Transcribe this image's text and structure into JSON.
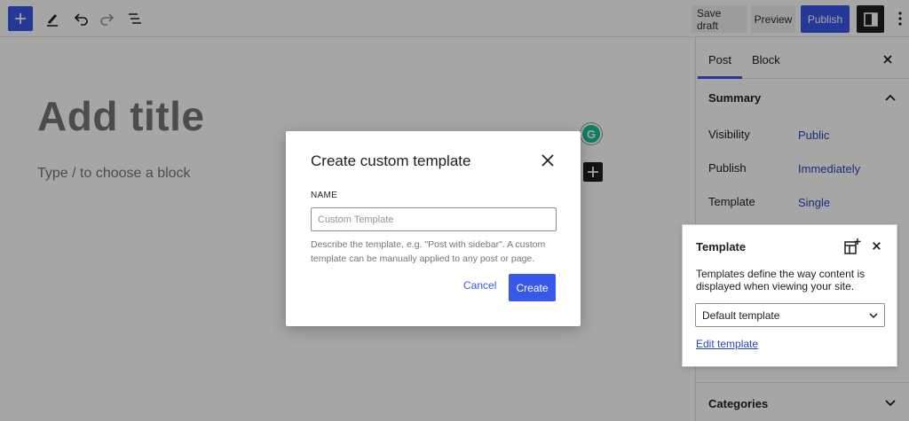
{
  "toolbar": {
    "save_draft": "Save draft",
    "preview": "Preview",
    "publish": "Publish"
  },
  "editor": {
    "title_placeholder": "Add title",
    "block_placeholder": "Type / to choose a block"
  },
  "grammarly_letter": "G",
  "sidebar": {
    "tabs": [
      "Post",
      "Block"
    ],
    "summary_title": "Summary",
    "rows": [
      {
        "label": "Visibility",
        "value": "Public"
      },
      {
        "label": "Publish",
        "value": "Immediately"
      },
      {
        "label": "Template",
        "value": "Single"
      }
    ],
    "categories_title": "Categories"
  },
  "template_popover": {
    "title": "Template",
    "description": "Templates define the way content is displayed when viewing your site.",
    "selected": "Default template",
    "edit_link": "Edit template"
  },
  "modal": {
    "title": "Create custom template",
    "name_label": "NAME",
    "name_placeholder": "Custom Template",
    "help": "Describe the template, e.g. \"Post with sidebar\". A custom template can be manually applied to any post or page.",
    "cancel": "Cancel",
    "create": "Create"
  },
  "colors": {
    "accent": "#3858e9",
    "link": "#2945c4",
    "dark": "#1e1e1e",
    "overlay": "rgba(0,0,0,0.35)"
  },
  "icons": [
    "plus-icon",
    "pen-icon",
    "undo-icon",
    "redo-icon",
    "list-view-icon",
    "sidebar-icon",
    "more-vertical-icon",
    "close-icon",
    "chevron-up-icon",
    "chevron-down-icon",
    "add-template-icon"
  ]
}
